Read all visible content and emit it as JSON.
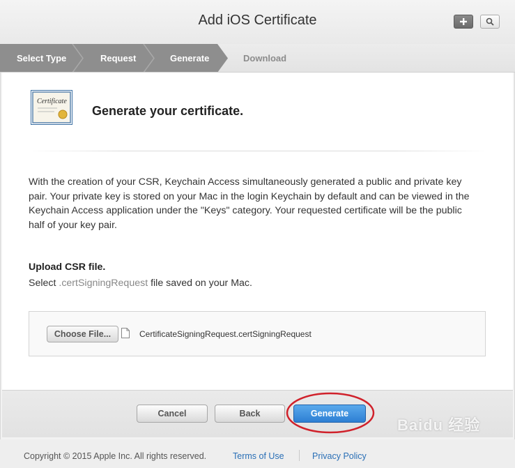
{
  "window": {
    "title": "Add iOS Certificate"
  },
  "toolbar": {
    "add_icon": "plus-icon",
    "search_icon": "search-icon"
  },
  "steps": [
    {
      "label": "Select Type",
      "state": "done"
    },
    {
      "label": "Request",
      "state": "done"
    },
    {
      "label": "Generate",
      "state": "current"
    },
    {
      "label": "Download",
      "state": "pending"
    }
  ],
  "main": {
    "cert_icon_text": "Certificate",
    "heading": "Generate your certificate.",
    "description": "With the creation of your CSR, Keychain Access simultaneously generated a public and private key pair. Your private key is stored on your Mac in the login Keychain by default and can be viewed in the Keychain Access application under the \"Keys\" category. Your requested certificate will be the public half of your key pair.",
    "upload_title": "Upload CSR file.",
    "upload_prefix": "Select ",
    "upload_ext": ".certSigningRequest",
    "upload_suffix": " file saved on your Mac.",
    "choose_file_label": "Choose File...",
    "file_name": "CertificateSigningRequest.certSigningRequest"
  },
  "actions": {
    "cancel_label": "Cancel",
    "back_label": "Back",
    "generate_label": "Generate"
  },
  "footer": {
    "copyright": "Copyright © 2015 Apple Inc. All rights reserved.",
    "terms_label": "Terms of Use",
    "privacy_label": "Privacy Policy"
  },
  "watermark": "Baidu 经验",
  "colors": {
    "accent": "#2d7fd4",
    "step_active_bg": "#8c8c8c",
    "highlight_ring": "#d0212b",
    "link": "#2a6fb6"
  }
}
